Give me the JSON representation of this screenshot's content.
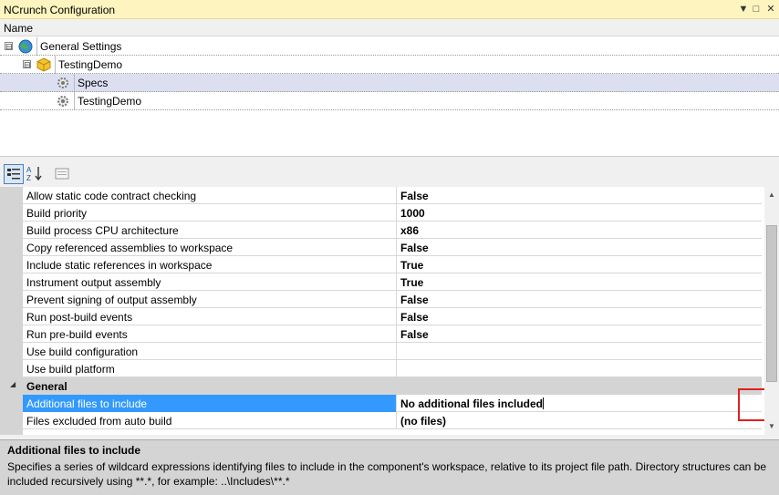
{
  "window": {
    "title": "NCrunch Configuration",
    "controls": [
      "▼",
      "□",
      "✕"
    ]
  },
  "tree": {
    "column_header": "Name",
    "items": [
      {
        "label": "General Settings",
        "icon": "globe-icon",
        "expander": "⊟"
      },
      {
        "label": "TestingDemo",
        "icon": "solution-cube-icon",
        "expander": "⊟"
      },
      {
        "label": "Specs",
        "icon": "project-gear-icon",
        "selected": true
      },
      {
        "label": "TestingDemo",
        "icon": "project-gear-icon"
      }
    ]
  },
  "toolbar": {
    "buttons": [
      {
        "icon": "categorized-view-icon",
        "active": true
      },
      {
        "icon": "alphabetical-sort-icon",
        "active": false
      },
      {
        "icon": "property-pages-icon",
        "active": false
      }
    ]
  },
  "properties": {
    "rows": [
      {
        "name": "Allow static code contract checking",
        "value": "False"
      },
      {
        "name": "Build priority",
        "value": "1000"
      },
      {
        "name": "Build process CPU architecture",
        "value": "x86"
      },
      {
        "name": "Copy referenced assemblies to workspace",
        "value": "False"
      },
      {
        "name": "Include static references in workspace",
        "value": "True"
      },
      {
        "name": "Instrument output assembly",
        "value": "True"
      },
      {
        "name": "Prevent signing of output assembly",
        "value": "False"
      },
      {
        "name": "Run post-build events",
        "value": "False"
      },
      {
        "name": "Run pre-build events",
        "value": "False"
      },
      {
        "name": "Use build configuration",
        "value": ""
      },
      {
        "name": "Use build platform",
        "value": ""
      }
    ],
    "category": {
      "label": "General",
      "expander": "◢"
    },
    "general_rows": [
      {
        "name": "Additional files to include",
        "value": "No additional files included",
        "selected": true,
        "button": "..."
      },
      {
        "name": "Files excluded from auto build",
        "value": "(no files)"
      }
    ]
  },
  "description": {
    "title": "Additional files to include",
    "text": "Specifies a series of wildcard expressions identifying files to include in the component's workspace, relative to its project file path.  Directory structures can be included recursively using **.*, for example: ..\\Includes\\**.*"
  },
  "colors": {
    "title_bar": "#fdf4bf",
    "selection": "#3399ff",
    "tree_selection": "#dcdff0",
    "highlight": "#e0201f"
  }
}
